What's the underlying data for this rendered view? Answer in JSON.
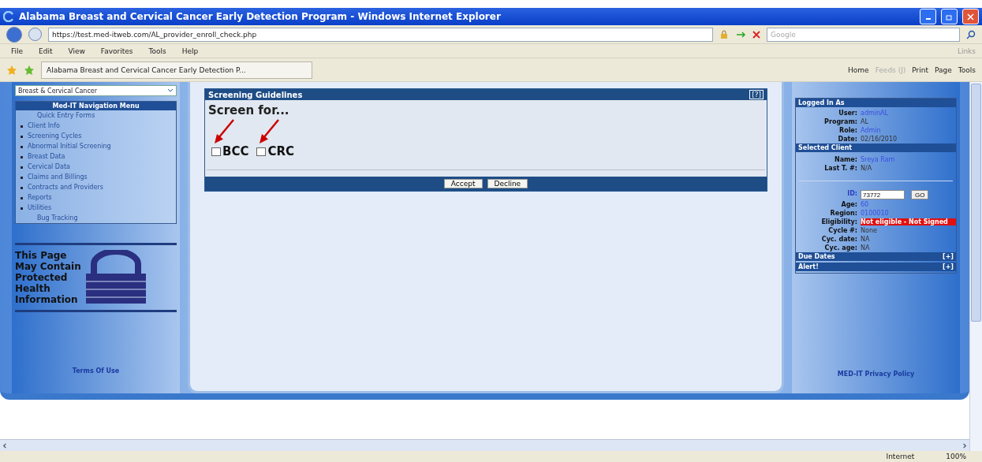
{
  "window": {
    "title": "Alabama Breast and Cervical Cancer Early Detection Program - Windows Internet Explorer"
  },
  "address_bar": {
    "url": "https://test.med-itweb.com/AL_provider_enroll_check.php",
    "search_placeholder": "Google"
  },
  "menu": [
    "File",
    "Edit",
    "View",
    "Favorites",
    "Tools",
    "Help"
  ],
  "links_label": "Links",
  "tab": {
    "title": "Alabama Breast and Cervical Cancer Early Detection P..."
  },
  "command_bar": [
    {
      "label": "Home",
      "disabled": false
    },
    {
      "label": "Feeds (J)",
      "disabled": true
    },
    {
      "label": "Print",
      "disabled": false
    },
    {
      "label": "Page",
      "disabled": false
    },
    {
      "label": "Tools",
      "disabled": false
    }
  ],
  "sidebar": {
    "program_select": "Breast & Cervical Cancer",
    "menu_title": "Med-IT Navigation Menu",
    "items": [
      {
        "label": "Quick Entry Forms",
        "bullet": false
      },
      {
        "label": "Client Info",
        "bullet": true
      },
      {
        "label": "Screening Cycles",
        "bullet": true
      },
      {
        "label": "Abnormal Initial Screening",
        "bullet": true
      },
      {
        "label": "Breast Data",
        "bullet": true
      },
      {
        "label": "Cervical Data",
        "bullet": true
      },
      {
        "label": "Claims and Billings",
        "bullet": true
      },
      {
        "label": "Contracts and Providers",
        "bullet": true
      },
      {
        "label": "Reports",
        "bullet": true
      },
      {
        "label": "Utilities",
        "bullet": true
      },
      {
        "label": "Bug Tracking",
        "bullet": false
      }
    ],
    "phi_notice": [
      "This Page",
      "May Contain",
      "Protected",
      "Health",
      "Information"
    ],
    "terms_link": "Terms Of Use"
  },
  "panel": {
    "title": "Screening Guidelines",
    "help": "[?]",
    "heading": "Screen for...",
    "options": [
      {
        "label": "BCC",
        "checked": false
      },
      {
        "label": "CRC",
        "checked": false
      }
    ],
    "buttons": [
      "Accept",
      "Decline"
    ]
  },
  "right_panel": {
    "logged_in_title": "Logged In As",
    "logged_in": [
      {
        "label": "User:",
        "value": "adminAL",
        "kind": "link"
      },
      {
        "label": "Program:",
        "value": "AL",
        "kind": "text"
      },
      {
        "label": "Role:",
        "value": "Admin",
        "kind": "link"
      },
      {
        "label": "Date:",
        "value": "02/16/2010",
        "kind": "text"
      }
    ],
    "client_title": "Selected Client",
    "client": [
      {
        "label": "Name:",
        "value": "Sreya Ram",
        "kind": "link"
      },
      {
        "label": "Last T. #:",
        "value": "N/A",
        "kind": "text"
      }
    ],
    "id_label": "ID:",
    "id_value": "73772",
    "go_button": "GO",
    "details": [
      {
        "label": "Age:",
        "value": "60",
        "kind": "link"
      },
      {
        "label": "Region:",
        "value": "0100010",
        "kind": "link"
      },
      {
        "label": "Eligibility:",
        "value": "Not eligible - Not Signed",
        "kind": "alert"
      },
      {
        "label": "Cycle #:",
        "value": "None",
        "kind": "text"
      },
      {
        "label": "Cyc. date:",
        "value": "NA",
        "kind": "text"
      },
      {
        "label": "Cyc. age:",
        "value": "NA",
        "kind": "text"
      }
    ],
    "sections": [
      {
        "title": "Due Dates",
        "toggle": "[+]"
      },
      {
        "title": "Alert!",
        "toggle": "[+]"
      }
    ],
    "privacy_link": "MED-IT Privacy Policy"
  },
  "status_bar": {
    "zone": "Internet",
    "zoom": "100%"
  }
}
